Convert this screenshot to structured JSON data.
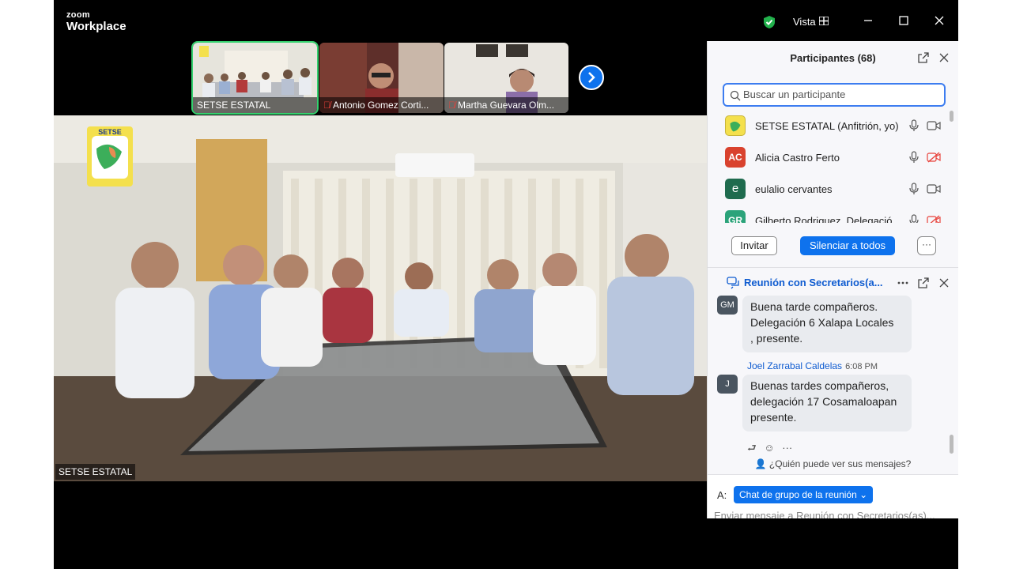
{
  "app": {
    "brand_top": "zoom",
    "brand_bottom": "Workplace",
    "view_label": "Vista"
  },
  "thumbnails": [
    {
      "name": "SETSE ESTATAL",
      "muted": false,
      "active": true
    },
    {
      "name": "Antonio Gomez Corti...",
      "muted": true,
      "active": false
    },
    {
      "name": "Martha Guevara Olm...",
      "muted": true,
      "active": false
    }
  ],
  "main_video": {
    "label": "SETSE ESTATAL",
    "logo_text": "SETSE"
  },
  "participants_panel": {
    "title": "Participantes (68)",
    "search_placeholder": "Buscar un participante",
    "participants": [
      {
        "initials": "",
        "name": "SETSE ESTATAL (Anfitrión, yo)",
        "avatar_color": "#f4e04d",
        "video_off": false
      },
      {
        "initials": "AC",
        "name": "Alicia Castro Ferto",
        "avatar_color": "#d9422e",
        "video_off": true
      },
      {
        "initials": "e",
        "name": "eulalio cervantes",
        "avatar_color": "#1f6b4e",
        "video_off": false
      },
      {
        "initials": "GR",
        "name": "Gilberto Rodriguez, Delegació",
        "avatar_color": "#2ba37a",
        "video_off": true
      }
    ],
    "invite_label": "Invitar",
    "mute_all_label": "Silenciar a todos",
    "more_label": "···"
  },
  "chat_panel": {
    "title": "Reunión con Secretarios(a...",
    "messages": [
      {
        "avatar": "GM",
        "sender": "",
        "time": "",
        "lines": [
          "Buena tarde compañeros.",
          "Delegación 6 Xalapa Locales",
          ", presente."
        ]
      },
      {
        "avatar": "J",
        "sender": "Joel Zarrabal Caldelas",
        "time": "6:08 PM",
        "lines": [
          "Buenas tardes compañeros,",
          "delegación 17 Cosamaloapan",
          "presente."
        ]
      }
    ],
    "who_can_see": "¿Quién puede ver sus mensajes?",
    "to_label": "A:",
    "to_value": "Chat de grupo de la reunión",
    "input_placeholder": "Enviar mensaje a Reunión con Secretarios(as)..."
  }
}
